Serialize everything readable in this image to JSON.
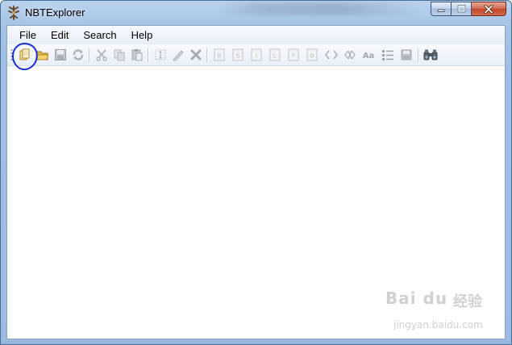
{
  "window": {
    "title": "NBTExplorer",
    "app_icon": "nbt-tree-icon",
    "caption_buttons": [
      "minimize-icon",
      "maximize-icon",
      "close-icon"
    ]
  },
  "menu": {
    "items": [
      {
        "label": "File",
        "name": "menu-file"
      },
      {
        "label": "Edit",
        "name": "menu-edit"
      },
      {
        "label": "Search",
        "name": "menu-search"
      },
      {
        "label": "Help",
        "name": "menu-help"
      }
    ]
  },
  "toolbar": {
    "buttons": [
      {
        "name": "open-file-button",
        "icon": "open-file-icon",
        "enabled": true
      },
      {
        "name": "open-folder-button",
        "icon": "open-folder-icon",
        "enabled": true
      },
      {
        "name": "save-button",
        "icon": "save-icon",
        "enabled": false
      },
      {
        "name": "refresh-button",
        "icon": "refresh-icon",
        "enabled": false
      },
      {
        "name": "cut-button",
        "icon": "cut-icon",
        "enabled": false
      },
      {
        "name": "copy-button",
        "icon": "copy-icon",
        "enabled": false
      },
      {
        "name": "paste-button",
        "icon": "paste-icon",
        "enabled": false
      },
      {
        "name": "rename-button",
        "icon": "rename-icon",
        "enabled": false
      },
      {
        "name": "edit-value-button",
        "icon": "pencil-icon",
        "enabled": false
      },
      {
        "name": "delete-button",
        "icon": "delete-icon",
        "enabled": false
      },
      {
        "name": "add-byte-button",
        "icon": "tag-b-icon",
        "letter": "B",
        "enabled": false
      },
      {
        "name": "add-short-button",
        "icon": "tag-s-icon",
        "letter": "S",
        "enabled": false
      },
      {
        "name": "add-int-button",
        "icon": "tag-i-icon",
        "letter": "I",
        "enabled": false
      },
      {
        "name": "add-long-button",
        "icon": "tag-l-icon",
        "letter": "L",
        "enabled": false
      },
      {
        "name": "add-float-button",
        "icon": "tag-f-icon",
        "letter": "F",
        "enabled": false
      },
      {
        "name": "add-double-button",
        "icon": "tag-d-icon",
        "letter": "D",
        "enabled": false
      },
      {
        "name": "add-byte-array-button",
        "icon": "byte-array-icon",
        "enabled": false
      },
      {
        "name": "add-int-array-button",
        "icon": "int-array-icon",
        "enabled": false
      },
      {
        "name": "add-string-button",
        "icon": "string-icon",
        "letter": "Aa",
        "enabled": false
      },
      {
        "name": "add-list-button",
        "icon": "list-icon",
        "enabled": false
      },
      {
        "name": "add-compound-button",
        "icon": "compound-icon",
        "enabled": false
      },
      {
        "name": "find-button",
        "icon": "binoculars-icon",
        "enabled": true
      }
    ]
  },
  "colors": {
    "annotation_circle": "#1a2ed6",
    "disabled_icon": "#b4b8bf",
    "enabled_folder": "#e8b64a"
  },
  "watermark": {
    "logo": "Bai du",
    "cn": "经验",
    "url": "jingyan.baidu.com"
  }
}
